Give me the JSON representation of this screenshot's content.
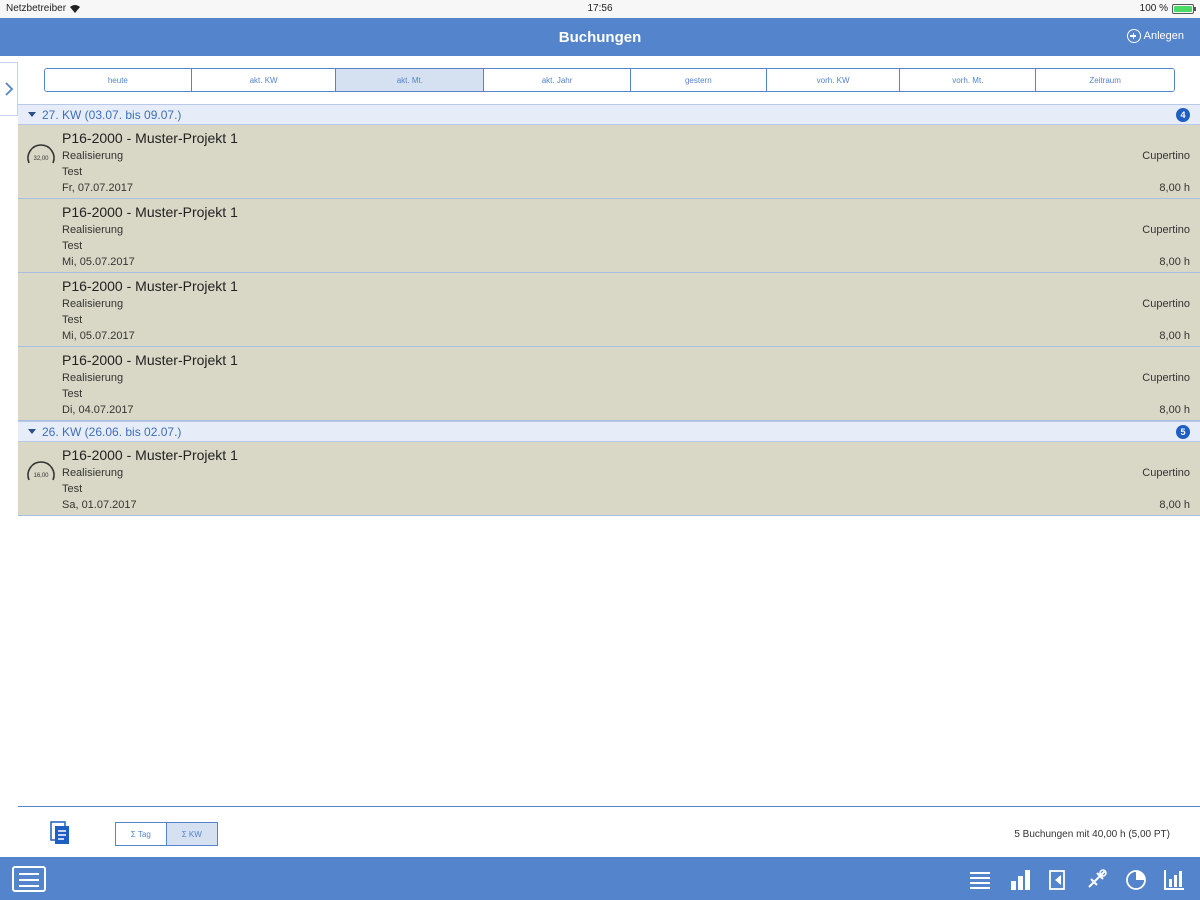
{
  "status_bar": {
    "carrier": "Netzbetreiber",
    "time": "17:56",
    "battery": "100 %"
  },
  "navbar": {
    "title": "Buchungen",
    "add_label": "Anlegen"
  },
  "filters": [
    {
      "label": "heute",
      "active": false
    },
    {
      "label": "akt. KW",
      "active": false
    },
    {
      "label": "akt. Mt.",
      "active": true
    },
    {
      "label": "akt. Jahr",
      "active": false
    },
    {
      "label": "gestern",
      "active": false
    },
    {
      "label": "vorh. KW",
      "active": false
    },
    {
      "label": "vorh. Mt.",
      "active": false
    },
    {
      "label": "Zeitraum",
      "active": false
    }
  ],
  "groups": [
    {
      "title": "27. KW (03.07. bis 09.07.)",
      "count": "4",
      "entries": [
        {
          "project": "P16-2000 - Muster-Projekt 1",
          "phase": "Realisierung",
          "description": "Test",
          "date": "Fr, 07.07.2017",
          "location": "Cupertino",
          "hours": "8,00 h",
          "gauge": "32,00"
        },
        {
          "project": "P16-2000 - Muster-Projekt 1",
          "phase": "Realisierung",
          "description": "Test",
          "date": "Mi, 05.07.2017",
          "location": "Cupertino",
          "hours": "8,00 h",
          "gauge": ""
        },
        {
          "project": "P16-2000 - Muster-Projekt 1",
          "phase": "Realisierung",
          "description": "Test",
          "date": "Mi, 05.07.2017",
          "location": "Cupertino",
          "hours": "8,00 h",
          "gauge": ""
        },
        {
          "project": "P16-2000 - Muster-Projekt 1",
          "phase": "Realisierung",
          "description": "Test",
          "date": "Di, 04.07.2017",
          "location": "Cupertino",
          "hours": "8,00 h",
          "gauge": ""
        }
      ]
    },
    {
      "title": "26. KW (26.06. bis 02.07.)",
      "count": "5",
      "entries": [
        {
          "project": "P16-2000 - Muster-Projekt 1",
          "phase": "Realisierung",
          "description": "Test",
          "date": "Sa, 01.07.2017",
          "location": "Cupertino",
          "hours": "8,00 h",
          "gauge": "16,00"
        }
      ]
    }
  ],
  "bottom": {
    "toggle": [
      {
        "label": "Σ Tag",
        "active": false
      },
      {
        "label": "Σ KW",
        "active": true
      }
    ],
    "summary": "5 Buchungen mit 40,00 h (5,00 PT)"
  },
  "tabbar": {
    "icons": [
      "list-icon",
      "bar-chart-icon",
      "export-icon",
      "satellite-icon",
      "pie-chart-icon",
      "stats-icon"
    ]
  },
  "colors": {
    "accent": "#5384cc",
    "row_bg": "#d9d8c6",
    "badge": "#1f5fc4"
  }
}
